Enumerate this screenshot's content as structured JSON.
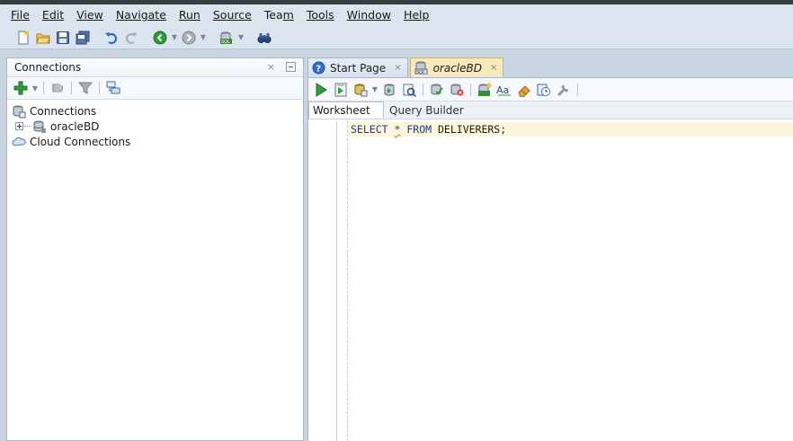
{
  "menu": {
    "items": [
      {
        "label": "File",
        "mnemonic_index": 0
      },
      {
        "label": "Edit",
        "mnemonic_index": 0
      },
      {
        "label": "View",
        "mnemonic_index": 0
      },
      {
        "label": "Navigate",
        "mnemonic_index": 0
      },
      {
        "label": "Run",
        "mnemonic_index": 0
      },
      {
        "label": "Source",
        "mnemonic_index": 0
      },
      {
        "label": "Team",
        "mnemonic_index": 3
      },
      {
        "label": "Tools",
        "mnemonic_index": 0
      },
      {
        "label": "Window",
        "mnemonic_index": 0
      },
      {
        "label": "Help",
        "mnemonic_index": 0
      }
    ]
  },
  "toolbar": {
    "icons": [
      "new-file-icon",
      "open-folder-icon",
      "save-icon",
      "save-all-icon",
      "undo-icon",
      "redo-icon",
      "back-icon",
      "forward-icon",
      "sql-connection-icon",
      "binoculars-icon"
    ]
  },
  "connections_panel": {
    "title": "Connections",
    "close_glyph": "×",
    "tree": [
      {
        "label": "Connections",
        "icon": "connections-icon"
      },
      {
        "label": "oracleBD",
        "icon": "database-icon"
      },
      {
        "label": "Cloud Connections",
        "icon": "cloud-icon"
      }
    ]
  },
  "editor": {
    "tabs": [
      {
        "label": "Start Page",
        "icon": "help-icon",
        "close": "×"
      },
      {
        "label": "oracleBD",
        "icon": "sql-worksheet-icon",
        "close": "×",
        "active": true
      }
    ],
    "subtabs": {
      "worksheet": "Worksheet",
      "query_builder": "Query Builder"
    },
    "code": {
      "kw1": "SELECT",
      "star": "*",
      "kw2": "FROM",
      "rest": "DELIVERERS;"
    }
  },
  "colors": {
    "menubar_bg": "#dbe5f0",
    "active_tab_bg": "#f8e8bd",
    "current_line_bg": "#fdf6dc",
    "keyword": "#1f3c8c"
  }
}
